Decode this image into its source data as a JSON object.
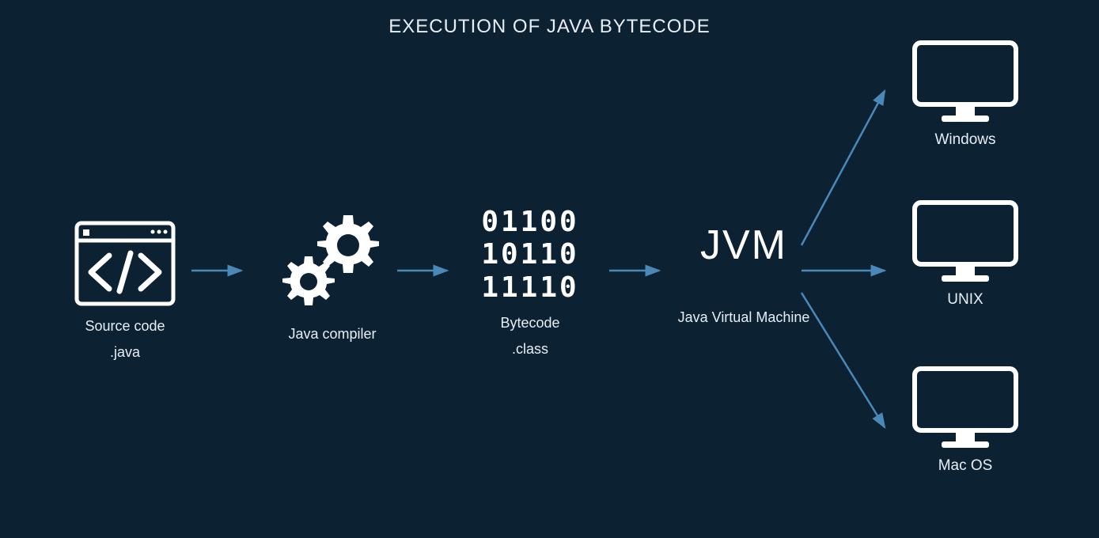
{
  "title": "EXECUTION OF JAVA BYTECODE",
  "nodes": {
    "source": {
      "label": "Source code",
      "sublabel": ".java"
    },
    "compiler": {
      "label": "Java compiler"
    },
    "bytecode": {
      "label": "Bytecode",
      "sublabel": ".class",
      "bits": [
        "01100",
        "10110",
        "11110"
      ]
    },
    "jvm": {
      "short": "JVM",
      "label": "Java Virtual Machine"
    },
    "targets": {
      "windows": "Windows",
      "unix": "UNIX",
      "macos": "Mac OS"
    }
  }
}
